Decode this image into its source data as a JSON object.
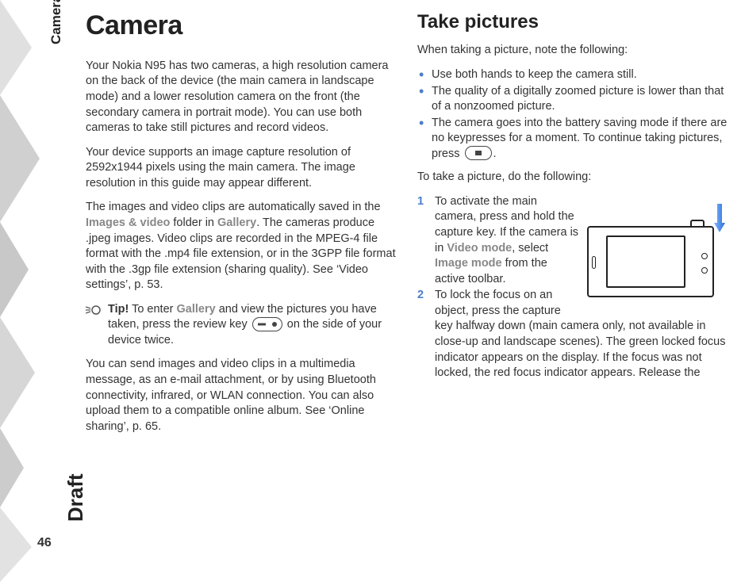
{
  "meta": {
    "section_tab": "Camera",
    "watermark": "Draft",
    "page_number": "46"
  },
  "left": {
    "title": "Camera",
    "p1": "Your Nokia N95 has two cameras, a high resolution camera on the back of the device (the main camera in landscape mode) and a lower resolution camera on the front (the secondary camera in portrait mode). You can use both cameras to take still pictures and record videos.",
    "p2": "Your device supports an image capture resolution of 2592x1944 pixels using the main camera. The image resolution in this guide may appear different.",
    "p3a": "The images and video clips are automatically saved in the ",
    "p3_ui1": "Images & video",
    "p3b": " folder in ",
    "p3_ui2": "Gallery",
    "p3c": ". The cameras produce .jpeg images. Video clips are recorded in the MPEG-4 file format with the .mp4 file extension, or in the 3GPP file format with the .3gp file extension (sharing quality). See ‘Video settings’, p. 53.",
    "tip_label": "Tip!",
    "tip_a": " To enter ",
    "tip_ui": "Gallery",
    "tip_b": " and view the pictures you have taken, press the review key ",
    "tip_c": " on the side of your device twice.",
    "p4": "You can send images and video clips in a multimedia message, as an e-mail attachment, or by using Bluetooth connectivity, infrared, or WLAN connection. You can also upload them to a compatible online album. See ‘Online sharing’, p. 65."
  },
  "right": {
    "heading": "Take pictures",
    "intro": "When taking a picture, note the following:",
    "bullets": [
      "Use both hands to keep the camera still.",
      "The quality of a digitally zoomed picture is lower than that of a nonzoomed picture.",
      "The camera goes into the battery saving mode if there are no keypresses for a moment. To continue taking pictures, press "
    ],
    "bullet3_tail": ".",
    "lead": "To take a picture, do the following:",
    "step1_num": "1",
    "step1_a": "To activate the main camera, press and hold the capture key. If the camera is in ",
    "step1_ui1": "Video mode",
    "step1_b": ", select ",
    "step1_ui2": "Image mode",
    "step1_c": " from the active toolbar.",
    "step2_num": "2",
    "step2": "To lock the focus on an object, press the capture key halfway down (main camera only, not available in close-up and landscape scenes). The green locked focus indicator appears on the display. If the focus was not locked, the red focus indicator appears. Release the"
  }
}
